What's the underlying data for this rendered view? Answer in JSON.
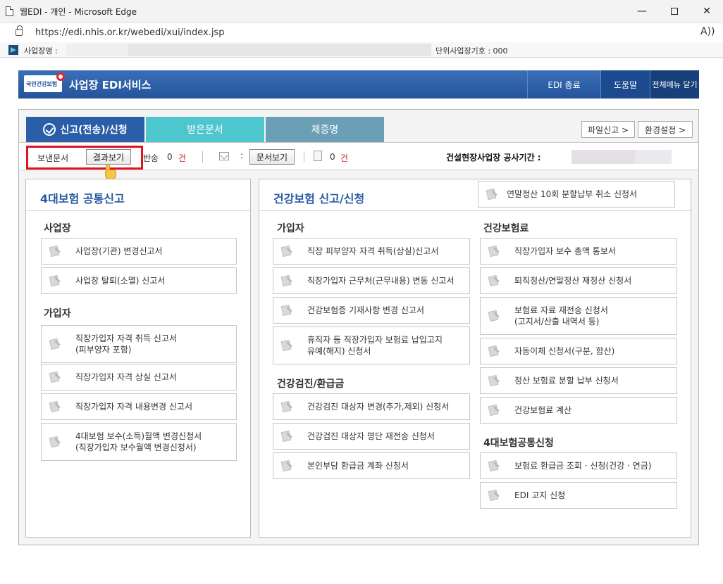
{
  "window": {
    "title": "웹EDI - 개인 - Microsoft Edge",
    "minimize": "—",
    "close": "✕"
  },
  "browser": {
    "url": "https://edi.nhis.or.kr/webedi/xui/index.jsp",
    "read_aloud": "A))"
  },
  "infobar": {
    "business_name_label": "사업장명 :",
    "unit_number_label": "단위사업장기호 : 000"
  },
  "header": {
    "logo_text": "국민건강보험",
    "service_title": "사업장 EDI서비스",
    "edi_end": "EDI 종료",
    "help": "도움말",
    "close_menu": "전체메뉴 닫기"
  },
  "tabs": [
    {
      "label": "신고(전송)/신청"
    },
    {
      "label": "받은문서"
    },
    {
      "label": "제증명"
    }
  ],
  "top_links": {
    "file_report": "파일신고 >",
    "settings": "환경설정 >"
  },
  "toolbar": {
    "sent_docs": "보낸문서",
    "view_result": "결과보기",
    "returned": "반송",
    "returned_count": "0",
    "unit": "건",
    "colon": ":",
    "view_docs": "문서보기",
    "doc_count": "0",
    "construction_label": "건설현장사업장 공사기간 :"
  },
  "left_panel": {
    "title": "4대보험 공통신고",
    "sections": [
      {
        "title": "사업장"
      },
      {
        "title": "가입자"
      }
    ],
    "items": [
      {
        "lines": [
          "사업장(기관) 변경신고서"
        ]
      },
      {
        "lines": [
          "사업장 탈퇴(소멸) 신고서"
        ]
      },
      {
        "lines": [
          "직장가입자 자격 취득 신고서",
          "(피부양자 포함)"
        ]
      },
      {
        "lines": [
          "직장가입자 자격 상실 신고서"
        ]
      },
      {
        "lines": [
          "직장가입자 자격 내용변경 신고서"
        ]
      },
      {
        "lines": [
          "4대보험 보수(소득)월액 변경신청서",
          "(직장가입자 보수월액 변경신청서)"
        ]
      }
    ]
  },
  "right_panel": {
    "title": "건강보험 신고/신청",
    "year_end_cancel": "연말정산 10회 분할납부 취소 신청서",
    "sections": [
      {
        "title": "가입자"
      },
      {
        "title": "건강검진/환급금"
      },
      {
        "title": "건강보험료"
      },
      {
        "title": "4대보험공통신청"
      }
    ],
    "col1_items": [
      {
        "lines": [
          "직장 피부양자 자격 취득(상실)신고서"
        ]
      },
      {
        "lines": [
          "직장가입자 근무처(근무내용) 변동 신고서"
        ]
      },
      {
        "lines": [
          "건강보험증 기재사항 변경 신고서"
        ]
      },
      {
        "lines": [
          "휴직자 등 직장가입자 보험료 납입고지",
          "유예(해지) 신청서"
        ]
      },
      {
        "lines": [
          "건강검진 대상자 변경(추가,제외) 신청서"
        ]
      },
      {
        "lines": [
          "건강검진 대상자 명단 재전송 신청서"
        ]
      },
      {
        "lines": [
          "본인부담 환급금 계좌 신청서"
        ]
      }
    ],
    "col2_items": [
      {
        "lines": [
          "직장가입자 보수 총액 통보서"
        ]
      },
      {
        "lines": [
          "퇴직정산/연말정산 재정산 신청서"
        ]
      },
      {
        "lines": [
          "보험료 자료 재전송 신청서",
          "(고지서/산출 내역서 등)"
        ]
      },
      {
        "lines": [
          "자동이체 신청서(구분, 합산)"
        ]
      },
      {
        "lines": [
          "정산 보험료 분할 납부 신청서"
        ]
      },
      {
        "lines": [
          "건강보험료 계산"
        ]
      },
      {
        "lines": [
          "보험료 환급금 조회 · 신청(건강 · 연금)"
        ]
      },
      {
        "lines": [
          "EDI 고지 신청"
        ]
      }
    ]
  }
}
